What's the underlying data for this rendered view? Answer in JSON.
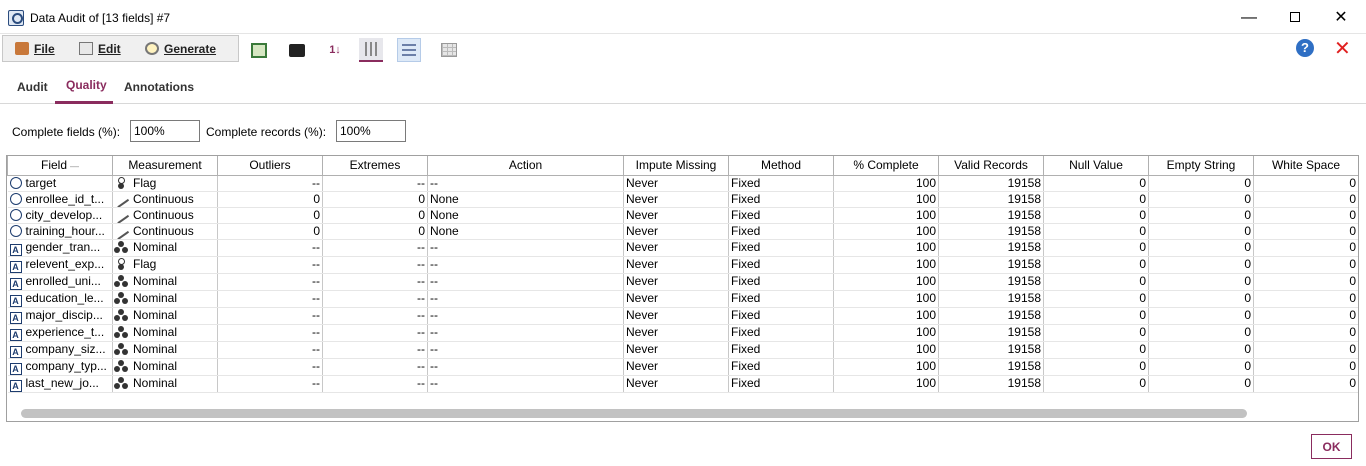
{
  "window": {
    "title": "Data Audit of [13 fields] #7",
    "minimize": "—",
    "close": "✕"
  },
  "menu": {
    "file": "File",
    "edit": "Edit",
    "generate": "Generate"
  },
  "toolbar": {
    "sort_label": "1↓",
    "help": "?",
    "close_glyph": "✕"
  },
  "tabs": [
    {
      "label": "Audit"
    },
    {
      "label": "Quality"
    },
    {
      "label": "Annotations"
    }
  ],
  "active_tab": "Quality",
  "filters": {
    "complete_fields_label": "Complete fields (%):",
    "complete_fields_value": "100%",
    "complete_records_label": "Complete records (%):",
    "complete_records_value": "100%"
  },
  "table": {
    "columns": [
      "Field",
      "Measurement",
      "Outliers",
      "Extremes",
      "Action",
      "Impute Missing",
      "Method",
      "% Complete",
      "Valid Records",
      "Null Value",
      "Empty String",
      "White Space"
    ],
    "sort_indicator": "—",
    "rows": [
      [
        "target",
        "Flag",
        "--",
        "--",
        "--",
        "Never",
        "Fixed",
        "100",
        "19158",
        "0",
        "0",
        "0"
      ],
      [
        "enrollee_id_t...",
        "Continuous",
        "0",
        "0",
        "None",
        "Never",
        "Fixed",
        "100",
        "19158",
        "0",
        "0",
        "0"
      ],
      [
        "city_develop...",
        "Continuous",
        "0",
        "0",
        "None",
        "Never",
        "Fixed",
        "100",
        "19158",
        "0",
        "0",
        "0"
      ],
      [
        "training_hour...",
        "Continuous",
        "0",
        "0",
        "None",
        "Never",
        "Fixed",
        "100",
        "19158",
        "0",
        "0",
        "0"
      ],
      [
        "gender_tran...",
        "Nominal",
        "--",
        "--",
        "--",
        "Never",
        "Fixed",
        "100",
        "19158",
        "0",
        "0",
        "0"
      ],
      [
        "relevent_exp...",
        "Flag",
        "--",
        "--",
        "--",
        "Never",
        "Fixed",
        "100",
        "19158",
        "0",
        "0",
        "0"
      ],
      [
        "enrolled_uni...",
        "Nominal",
        "--",
        "--",
        "--",
        "Never",
        "Fixed",
        "100",
        "19158",
        "0",
        "0",
        "0"
      ],
      [
        "education_le...",
        "Nominal",
        "--",
        "--",
        "--",
        "Never",
        "Fixed",
        "100",
        "19158",
        "0",
        "0",
        "0"
      ],
      [
        "major_discip...",
        "Nominal",
        "--",
        "--",
        "--",
        "Never",
        "Fixed",
        "100",
        "19158",
        "0",
        "0",
        "0"
      ],
      [
        "experience_t...",
        "Nominal",
        "--",
        "--",
        "--",
        "Never",
        "Fixed",
        "100",
        "19158",
        "0",
        "0",
        "0"
      ],
      [
        "company_siz...",
        "Nominal",
        "--",
        "--",
        "--",
        "Never",
        "Fixed",
        "100",
        "19158",
        "0",
        "0",
        "0"
      ],
      [
        "company_typ...",
        "Nominal",
        "--",
        "--",
        "--",
        "Never",
        "Fixed",
        "100",
        "19158",
        "0",
        "0",
        "0"
      ],
      [
        "last_new_jo...",
        "Nominal",
        "--",
        "--",
        "--",
        "Never",
        "Fixed",
        "100",
        "19158",
        "0",
        "0",
        "0"
      ]
    ],
    "field_types": [
      "continuous",
      "continuous",
      "continuous",
      "continuous",
      "string",
      "string",
      "string",
      "string",
      "string",
      "string",
      "string",
      "string",
      "string"
    ]
  },
  "footer": {
    "ok_label": "OK"
  },
  "colors": {
    "accent": "#8a2c5e",
    "help": "#2f6fc4",
    "close_red": "#e02020"
  }
}
